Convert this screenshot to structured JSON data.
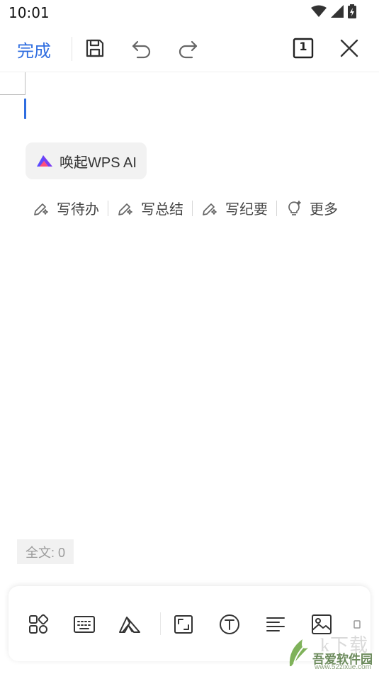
{
  "status_bar": {
    "time": "10:01"
  },
  "toolbar": {
    "done_label": "完成",
    "page_number": "1"
  },
  "ai_chip": {
    "label": "唤起WPS AI"
  },
  "suggestions": [
    {
      "label": "写待办",
      "icon": "pen-sparkle-icon"
    },
    {
      "label": "写总结",
      "icon": "pen-sparkle-icon"
    },
    {
      "label": "写纪要",
      "icon": "pen-sparkle-icon"
    },
    {
      "label": "更多",
      "icon": "bulb-icon"
    }
  ],
  "word_count": {
    "label": "全文: 0"
  },
  "bottom_toolbar": {
    "icons": [
      "apps-icon",
      "keyboard-icon",
      "font-style-icon",
      "fullscreen-icon",
      "text-box-icon",
      "align-left-icon",
      "image-icon",
      "more-icon"
    ]
  },
  "watermark": {
    "brand": "吾爱软件园",
    "url": "www.52zixue.com",
    "overlay": "k下载"
  },
  "colors": {
    "accent": "#2f6de0",
    "text": "#222222",
    "muted": "#9a9a9a"
  }
}
